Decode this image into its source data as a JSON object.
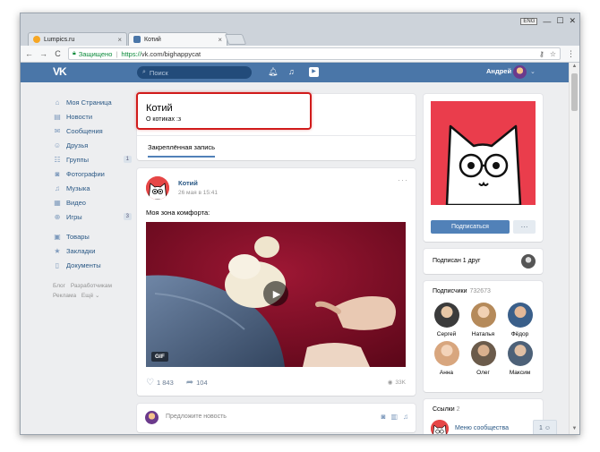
{
  "browser": {
    "tabs": [
      {
        "label": "Lumpics.ru",
        "favicon_color": "#f6a623"
      },
      {
        "label": "Котий",
        "favicon_color": "#4a76a8"
      }
    ],
    "tab_close": "×",
    "window_badge": "ENG",
    "window_controls": [
      "—",
      "☐",
      "✕"
    ],
    "address": {
      "secure_label": "Защищено",
      "scheme": "https://",
      "rest": "vk.com/bighappycat"
    },
    "nav": {
      "back": "←",
      "forward": "→",
      "reload": "C"
    },
    "omni_icons": {
      "key": "⚷",
      "star": "☆",
      "menu": "⋮"
    }
  },
  "vk": {
    "logo": "VK",
    "search_placeholder": "Поиск",
    "user_name": "Андрей",
    "colors": {
      "header": "#4a76a8",
      "link": "#2a5885",
      "accent": "#5181b8",
      "highlight": "#d11b1b",
      "cover": "#ea3d4c"
    }
  },
  "menu": {
    "items": [
      {
        "label": "Моя Страница",
        "icon": "⌂",
        "count": ""
      },
      {
        "label": "Новости",
        "icon": "▤",
        "count": ""
      },
      {
        "label": "Сообщения",
        "icon": "✉",
        "count": ""
      },
      {
        "label": "Друзья",
        "icon": "☺",
        "count": ""
      },
      {
        "label": "Группы",
        "icon": "☷",
        "count": "1"
      },
      {
        "label": "Фотографии",
        "icon": "◙",
        "count": ""
      },
      {
        "label": "Музыка",
        "icon": "♫",
        "count": ""
      },
      {
        "label": "Видео",
        "icon": "▦",
        "count": ""
      },
      {
        "label": "Игры",
        "icon": "⊕",
        "count": "3"
      }
    ],
    "items2": [
      {
        "label": "Товары",
        "icon": "▣"
      },
      {
        "label": "Закладки",
        "icon": "★"
      },
      {
        "label": "Документы",
        "icon": "▯"
      }
    ],
    "footer": [
      "Блог",
      "Разработчикам",
      "Реклама",
      "Ещё ⌄"
    ]
  },
  "profile": {
    "name": "Котий",
    "status": "О котиках :з",
    "pinned_tab": "Закреплённая запись"
  },
  "post": {
    "author": "Котий",
    "date": "26 мая в 15:41",
    "more": "···",
    "text": "Моя зона комфорта:",
    "gif_badge": "GIF",
    "play": "▶",
    "likes": "1 843",
    "reposts": "104",
    "views": "33K",
    "icons": {
      "like": "♡",
      "share": "➦",
      "views": "◉"
    }
  },
  "suggest": {
    "text": "Предложите новость",
    "icons": [
      "◙",
      "▥",
      "♫"
    ]
  },
  "right": {
    "subscribe": "Подписаться",
    "subscribe_more": "···",
    "friend_text": "Подписан 1 друг",
    "subs_title": "Подписчики",
    "subs_count": "732673",
    "subscribers": [
      {
        "name": "Сергей",
        "color": "#3b3b3b"
      },
      {
        "name": "Наталья",
        "color": "#b58a5a"
      },
      {
        "name": "Фёдор",
        "color": "#3a5f8a"
      },
      {
        "name": "Анна",
        "color": "#d8a67e"
      },
      {
        "name": "Олег",
        "color": "#6b5b4b"
      },
      {
        "name": "Максим",
        "color": "#4d6178"
      }
    ],
    "links_title": "Ссылки",
    "links_count": "2",
    "link_item": "Меню сообщества",
    "float_count": "1"
  }
}
